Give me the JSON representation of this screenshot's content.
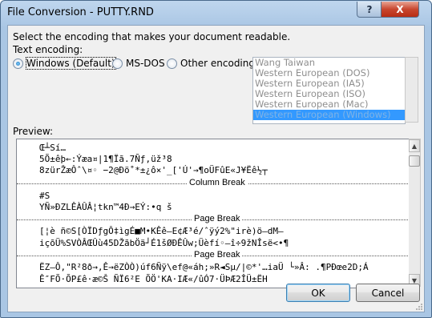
{
  "window": {
    "title": "File Conversion - PUTTY.RND",
    "help_label": "?",
    "close_label": "X"
  },
  "instruction": "Select the encoding that makes your document readable.",
  "text_encoding": {
    "label": "Text encoding:",
    "options": [
      {
        "label": "Windows (Default)",
        "checked": true
      },
      {
        "label": "MS-DOS",
        "checked": false
      },
      {
        "label": "Other encoding:",
        "checked": false
      }
    ]
  },
  "encoding_list": {
    "items": [
      "Wang Taiwan",
      "Western European (DOS)",
      "Western European (IA5)",
      "Western European (ISO)",
      "Western European (Mac)",
      "Western European (Windows)"
    ],
    "selected": "Western European (Windows)"
  },
  "preview": {
    "label": "Preview:",
    "lines": {
      "l1": "Œ┴Sí…",
      "l2": "5Õ±êþ←:Ýæa¤|1¶Ïã.7Ñƒ,üž³8",
      "l3": "8zürŽæÔˆ\\¤◦ −2@Ðö˚*±¿ô×'_['Ú'→¶oÜFûE«J¥Ëê½┬",
      "l4": "#S",
      "l5": "YÑ»ÐZLÊÀÛÂ¦tkn™4Ð→EÝ:•q š",
      "l6": "[¦è ñ©S[ÒÏDƒgÔ‡ìgÉ■M•KÊê–E¢Æ³é/ˆÿý2%\"irè)ö—dM—",
      "l7": "içõÜ%SVÒÂŒÛù45DŽãbÖä┘É1šØÐÊÛw;Üèfí◦–î÷9žNÎsë<•¶",
      "l8": "ËZ–Ô,\"R²8ð→,Ê→ëZÒÒ)úf6Ñÿ\\ef@«áh;»R◄Sµ/|©*'…iaÜ └»Â: .¶PÐœe2D;Á",
      "l9": "Ê″FÕ·ÕP£ê·æ©Š ÑÏ6²E ÕÖ'KA·IÆ«/ûÓ7·ÜÞÆ2ÎÜ±ËH"
    },
    "breaks": {
      "column": "Column Break",
      "page1": "Page Break",
      "page2": "Page Break"
    }
  },
  "buttons": {
    "ok": "OK",
    "cancel": "Cancel"
  }
}
